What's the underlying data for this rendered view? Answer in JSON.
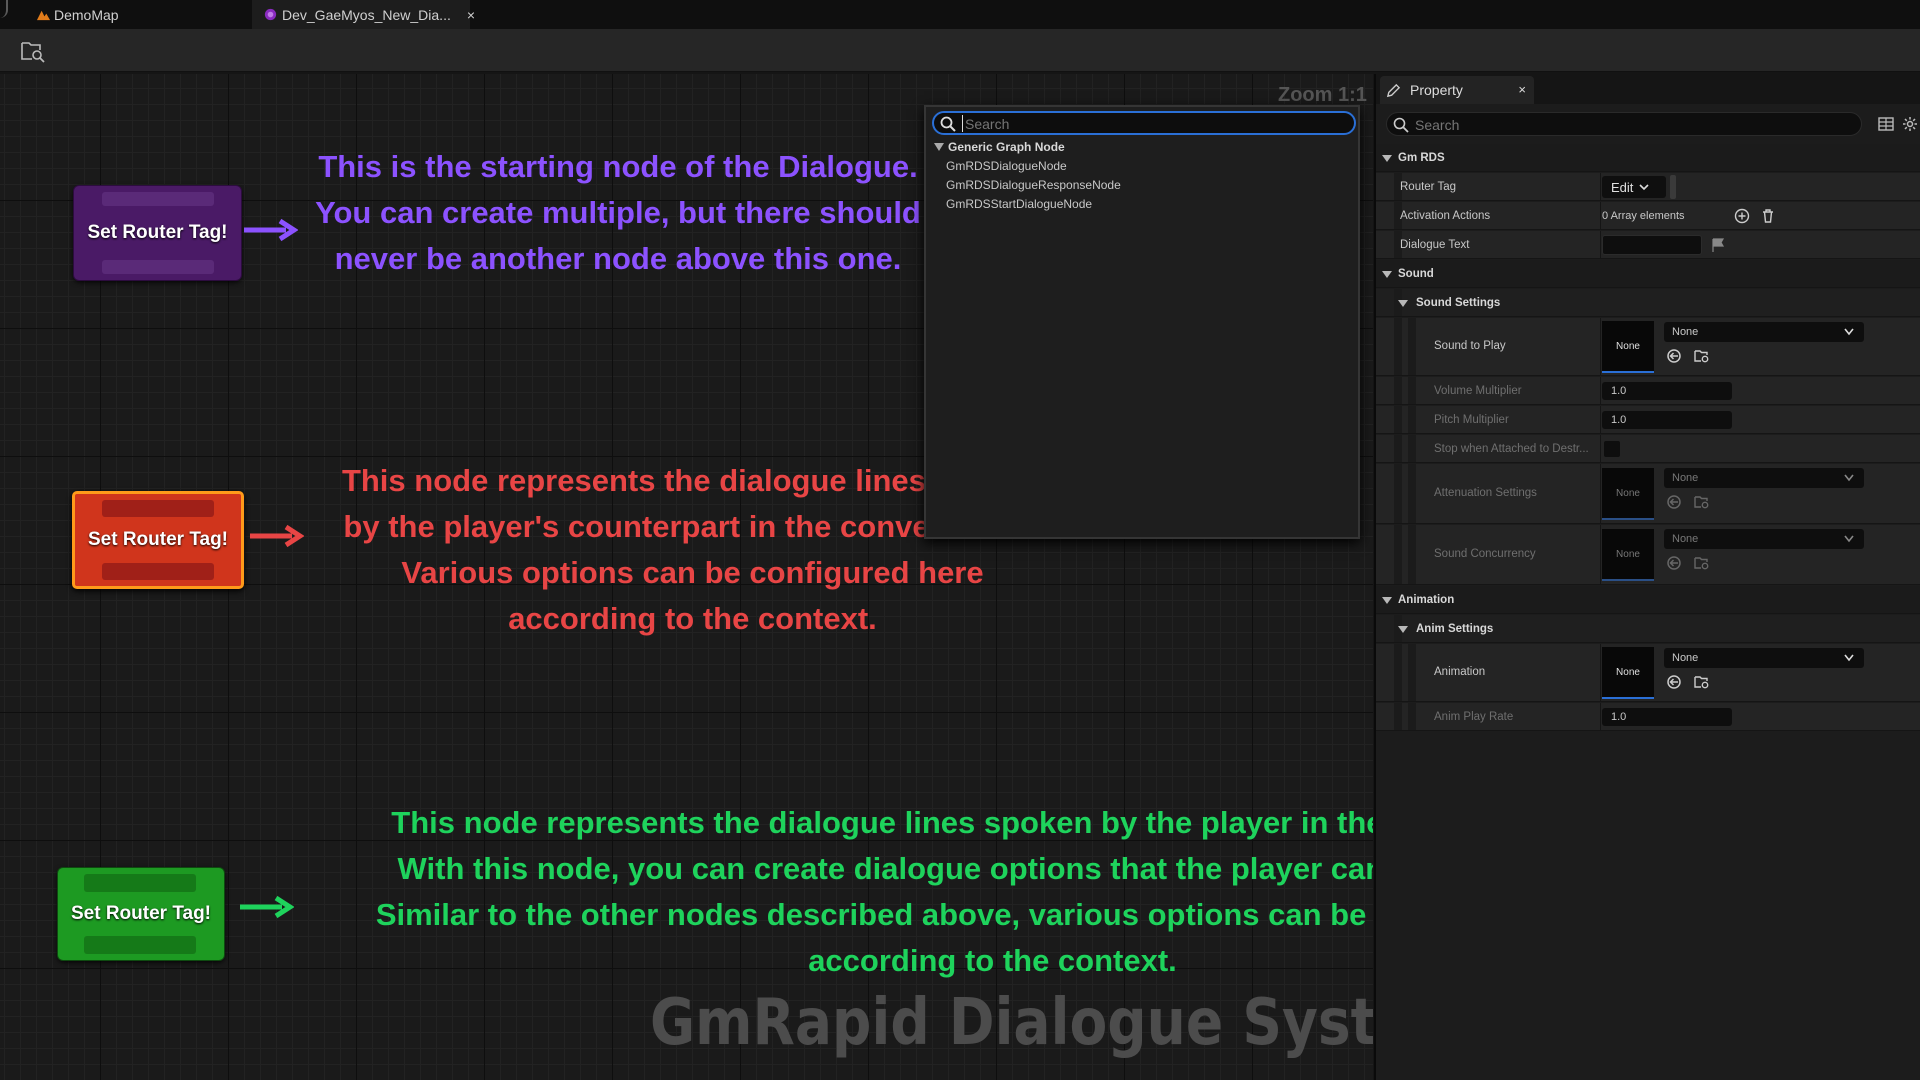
{
  "tabs": [
    {
      "label": "DemoMap"
    },
    {
      "label": "Dev_GaeMyos_New_Dia...",
      "close": "×"
    }
  ],
  "graph": {
    "zoom": "Zoom 1:1",
    "watermark": "GmRapid Dialogue System",
    "nodes": [
      {
        "label": "Set Router Tag!",
        "color": "#4a1a66"
      },
      {
        "label": "Set Router Tag!",
        "color": "#d0351c"
      },
      {
        "label": "Set Router Tag!",
        "color": "#1d9a22"
      }
    ],
    "descriptions": [
      {
        "color": "#8c52ff",
        "lines": [
          "This is the starting node of the Dialogue.",
          "You can create multiple, but there should",
          "never be another node above this one."
        ]
      },
      {
        "color": "#e84545",
        "lines": [
          "This node represents the dialogue lines spoken",
          "by the player's counterpart in the conversation.",
          "Various options can be configured here",
          "according to the context."
        ]
      },
      {
        "color": "#1ed35c",
        "lines": [
          "This node represents the dialogue lines spoken by the player in the conversation.",
          "With this node, you can create dialogue options that the player can choose from.",
          "Similar to the other nodes described above, various options can be configured here",
          "according to the context."
        ]
      }
    ]
  },
  "popup": {
    "search_placeholder": "Search",
    "category": "Generic Graph Node",
    "items": [
      "GmRDSDialogueNode",
      "GmRDSDialogueResponseNode",
      "GmRDSStartDialogueNode"
    ]
  },
  "panel": {
    "tab_label": "Property",
    "tab_close": "×",
    "search_placeholder": "Search",
    "sections": {
      "gm_rds": "Gm RDS",
      "router_tag": "Router Tag",
      "edit": "Edit",
      "activation_actions": "Activation Actions",
      "array_elements": "0 Array elements",
      "dialogue_text": "Dialogue Text",
      "sound": "Sound",
      "sound_settings": "Sound Settings",
      "sound_to_play": "Sound to Play",
      "none": "None",
      "volume_multiplier": "Volume Multiplier",
      "volume_value": "1.0",
      "pitch_multiplier": "Pitch Multiplier",
      "pitch_value": "1.0",
      "stop_when_attached": "Stop when Attached to Destr...",
      "attenuation_settings": "Attenuation Settings",
      "sound_concurrency": "Sound Concurrency",
      "animation_cat": "Animation",
      "anim_settings": "Anim Settings",
      "animation": "Animation",
      "anim_play_rate": "Anim Play Rate",
      "anim_play_rate_value": "1.0"
    }
  }
}
